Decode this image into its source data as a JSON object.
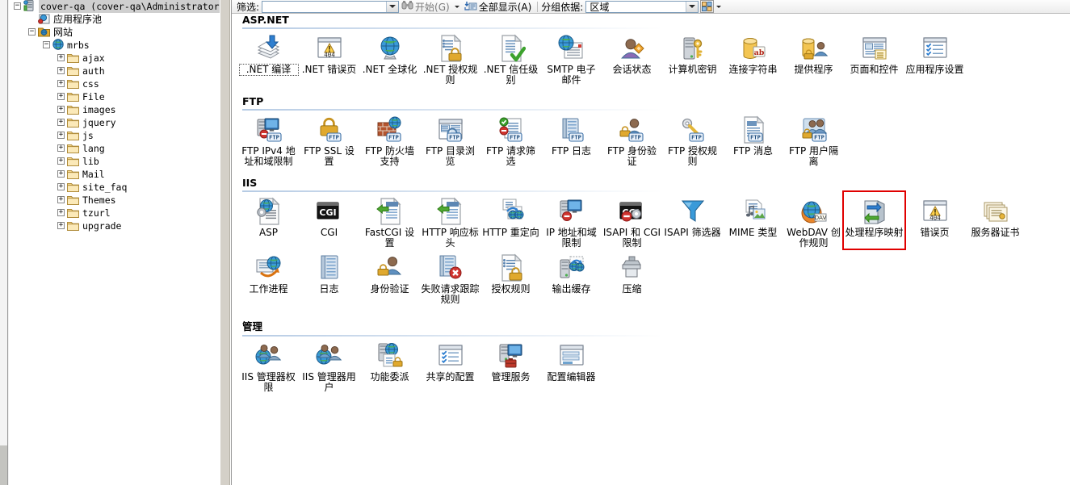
{
  "toolbar": {
    "filter_label": "筛选:",
    "filter_value": "",
    "filter_placeholder": "",
    "start_label": "开始(G)",
    "show_all_label": "全部显示(A)",
    "group_by_label": "分组依据:",
    "group_by_value": "区域"
  },
  "tree": {
    "items": [
      {
        "label": "cover-qa (cover-qa\\Administrator)",
        "indent": 6,
        "expander": "−",
        "icon": "server-icon",
        "selected": true,
        "cjk": false
      },
      {
        "label": "应用程序池",
        "indent": 24,
        "expander": "",
        "icon": "app-pools-icon",
        "selected": false,
        "cjk": true
      },
      {
        "label": "网站",
        "indent": 24,
        "expander": "−",
        "icon": "sites-folder-icon",
        "selected": false,
        "cjk": true
      },
      {
        "label": "mrbs",
        "indent": 42,
        "expander": "−",
        "icon": "website-icon",
        "selected": false,
        "cjk": false
      },
      {
        "label": "ajax",
        "indent": 60,
        "expander": "+",
        "icon": "folder-icon",
        "selected": false,
        "cjk": false
      },
      {
        "label": "auth",
        "indent": 60,
        "expander": "+",
        "icon": "folder-icon",
        "selected": false,
        "cjk": false
      },
      {
        "label": "css",
        "indent": 60,
        "expander": "+",
        "icon": "folder-icon",
        "selected": false,
        "cjk": false
      },
      {
        "label": "File",
        "indent": 60,
        "expander": "+",
        "icon": "folder-icon",
        "selected": false,
        "cjk": false
      },
      {
        "label": "images",
        "indent": 60,
        "expander": "+",
        "icon": "folder-icon",
        "selected": false,
        "cjk": false
      },
      {
        "label": "jquery",
        "indent": 60,
        "expander": "+",
        "icon": "folder-icon",
        "selected": false,
        "cjk": false
      },
      {
        "label": "js",
        "indent": 60,
        "expander": "+",
        "icon": "folder-icon",
        "selected": false,
        "cjk": false
      },
      {
        "label": "lang",
        "indent": 60,
        "expander": "+",
        "icon": "folder-icon",
        "selected": false,
        "cjk": false
      },
      {
        "label": "lib",
        "indent": 60,
        "expander": "+",
        "icon": "folder-icon",
        "selected": false,
        "cjk": false
      },
      {
        "label": "Mail",
        "indent": 60,
        "expander": "+",
        "icon": "folder-icon",
        "selected": false,
        "cjk": false
      },
      {
        "label": "site_faq",
        "indent": 60,
        "expander": "+",
        "icon": "folder-icon",
        "selected": false,
        "cjk": false
      },
      {
        "label": "Themes",
        "indent": 60,
        "expander": "+",
        "icon": "folder-icon",
        "selected": false,
        "cjk": false
      },
      {
        "label": "tzurl",
        "indent": 60,
        "expander": "+",
        "icon": "folder-icon",
        "selected": false,
        "cjk": false
      },
      {
        "label": "upgrade",
        "indent": 60,
        "expander": "+",
        "icon": "folder-icon",
        "selected": false,
        "cjk": false
      }
    ]
  },
  "sections": [
    {
      "title": "ASP.NET",
      "items": [
        {
          "label": ".NET 编译",
          "icon": "net-compilation-icon",
          "focused": true,
          "highlighted": false
        },
        {
          "label": ".NET 错误页",
          "icon": "error-pages-404-icon",
          "focused": false,
          "highlighted": false
        },
        {
          "label": ".NET 全球化",
          "icon": "globalization-icon",
          "focused": false,
          "highlighted": false
        },
        {
          "label": ".NET 授权规则",
          "icon": "auth-rules-lock-icon",
          "focused": false,
          "highlighted": false
        },
        {
          "label": ".NET 信任级别",
          "icon": "trust-levels-icon",
          "focused": false,
          "highlighted": false
        },
        {
          "label": "SMTP 电子邮件",
          "icon": "smtp-email-icon",
          "focused": false,
          "highlighted": false
        },
        {
          "label": "会话状态",
          "icon": "session-state-icon",
          "focused": false,
          "highlighted": false
        },
        {
          "label": "计算机密钥",
          "icon": "machine-key-icon",
          "focused": false,
          "highlighted": false
        },
        {
          "label": "连接字符串",
          "icon": "connection-strings-icon",
          "focused": false,
          "highlighted": false
        },
        {
          "label": "提供程序",
          "icon": "providers-icon",
          "focused": false,
          "highlighted": false
        },
        {
          "label": "页面和控件",
          "icon": "pages-controls-icon",
          "focused": false,
          "highlighted": false
        },
        {
          "label": "应用程序设置",
          "icon": "app-settings-icon",
          "focused": false,
          "highlighted": false
        }
      ]
    },
    {
      "title": "FTP",
      "items": [
        {
          "label": "FTP IPv4 地址和域限制",
          "icon": "ftp-ipv4-restrictions-icon",
          "focused": false,
          "highlighted": false
        },
        {
          "label": "FTP SSL 设置",
          "icon": "ftp-ssl-settings-icon",
          "focused": false,
          "highlighted": false
        },
        {
          "label": "FTP 防火墙支持",
          "icon": "ftp-firewall-icon",
          "focused": false,
          "highlighted": false
        },
        {
          "label": "FTP 目录浏览",
          "icon": "ftp-directory-browsing-icon",
          "focused": false,
          "highlighted": false
        },
        {
          "label": "FTP 请求筛选",
          "icon": "ftp-request-filtering-icon",
          "focused": false,
          "highlighted": false
        },
        {
          "label": "FTP 日志",
          "icon": "ftp-logging-icon",
          "focused": false,
          "highlighted": false
        },
        {
          "label": "FTP 身份验证",
          "icon": "ftp-authentication-icon",
          "focused": false,
          "highlighted": false
        },
        {
          "label": "FTP 授权规则",
          "icon": "ftp-auth-rules-icon",
          "focused": false,
          "highlighted": false
        },
        {
          "label": "FTP 消息",
          "icon": "ftp-messages-icon",
          "focused": false,
          "highlighted": false
        },
        {
          "label": "FTP 用户隔离",
          "icon": "ftp-user-isolation-icon",
          "focused": false,
          "highlighted": false
        }
      ]
    },
    {
      "title": "IIS",
      "items": [
        {
          "label": "ASP",
          "icon": "asp-icon",
          "focused": false,
          "highlighted": false
        },
        {
          "label": "CGI",
          "icon": "cgi-icon",
          "focused": false,
          "highlighted": false
        },
        {
          "label": "FastCGI 设置",
          "icon": "fastcgi-settings-icon",
          "focused": false,
          "highlighted": false
        },
        {
          "label": "HTTP 响应标头",
          "icon": "http-response-headers-icon",
          "focused": false,
          "highlighted": false
        },
        {
          "label": "HTTP 重定向",
          "icon": "http-redirect-icon",
          "focused": false,
          "highlighted": false
        },
        {
          "label": "IP 地址和域限制",
          "icon": "ip-restrictions-icon",
          "focused": false,
          "highlighted": false
        },
        {
          "label": "ISAPI 和 CGI 限制",
          "icon": "isapi-cgi-restrictions-icon",
          "focused": false,
          "highlighted": false
        },
        {
          "label": "ISAPI 筛选器",
          "icon": "isapi-filters-icon",
          "focused": false,
          "highlighted": false
        },
        {
          "label": "MIME 类型",
          "icon": "mime-types-icon",
          "focused": false,
          "highlighted": false
        },
        {
          "label": "WebDAV 创作规则",
          "icon": "webdav-icon",
          "focused": false,
          "highlighted": false
        },
        {
          "label": "处理程序映射",
          "icon": "handler-mappings-icon",
          "focused": false,
          "highlighted": true
        },
        {
          "label": "错误页",
          "icon": "error-pages-404-icon",
          "focused": false,
          "highlighted": false
        },
        {
          "label": "服务器证书",
          "icon": "server-certificates-icon",
          "focused": false,
          "highlighted": false
        },
        {
          "label": "工作进程",
          "icon": "worker-processes-icon",
          "focused": false,
          "highlighted": false
        },
        {
          "label": "日志",
          "icon": "logging-icon",
          "focused": false,
          "highlighted": false
        },
        {
          "label": "身份验证",
          "icon": "authentication-icon",
          "focused": false,
          "highlighted": false
        },
        {
          "label": "失败请求跟踪规则",
          "icon": "failed-request-tracing-icon",
          "focused": false,
          "highlighted": false
        },
        {
          "label": "授权规则",
          "icon": "authorization-rules-icon",
          "focused": false,
          "highlighted": false
        },
        {
          "label": "输出缓存",
          "icon": "output-caching-icon",
          "focused": false,
          "highlighted": false
        },
        {
          "label": "压缩",
          "icon": "compression-icon",
          "focused": false,
          "highlighted": false
        }
      ]
    },
    {
      "title": "管理",
      "items": [
        {
          "label": "IIS 管理器权限",
          "icon": "iis-manager-permissions-icon",
          "focused": false,
          "highlighted": false
        },
        {
          "label": "IIS 管理器用户",
          "icon": "iis-manager-users-icon",
          "focused": false,
          "highlighted": false
        },
        {
          "label": "功能委派",
          "icon": "feature-delegation-icon",
          "focused": false,
          "highlighted": false
        },
        {
          "label": "共享的配置",
          "icon": "shared-configuration-icon",
          "focused": false,
          "highlighted": false
        },
        {
          "label": "管理服务",
          "icon": "management-service-icon",
          "focused": false,
          "highlighted": false
        },
        {
          "label": "配置编辑器",
          "icon": "configuration-editor-icon",
          "focused": false,
          "highlighted": false
        }
      ]
    }
  ],
  "colors": {
    "highlight_border": "#e00000",
    "selection_background": "#cfcfcf",
    "section_rule": "#b6cbe4"
  }
}
